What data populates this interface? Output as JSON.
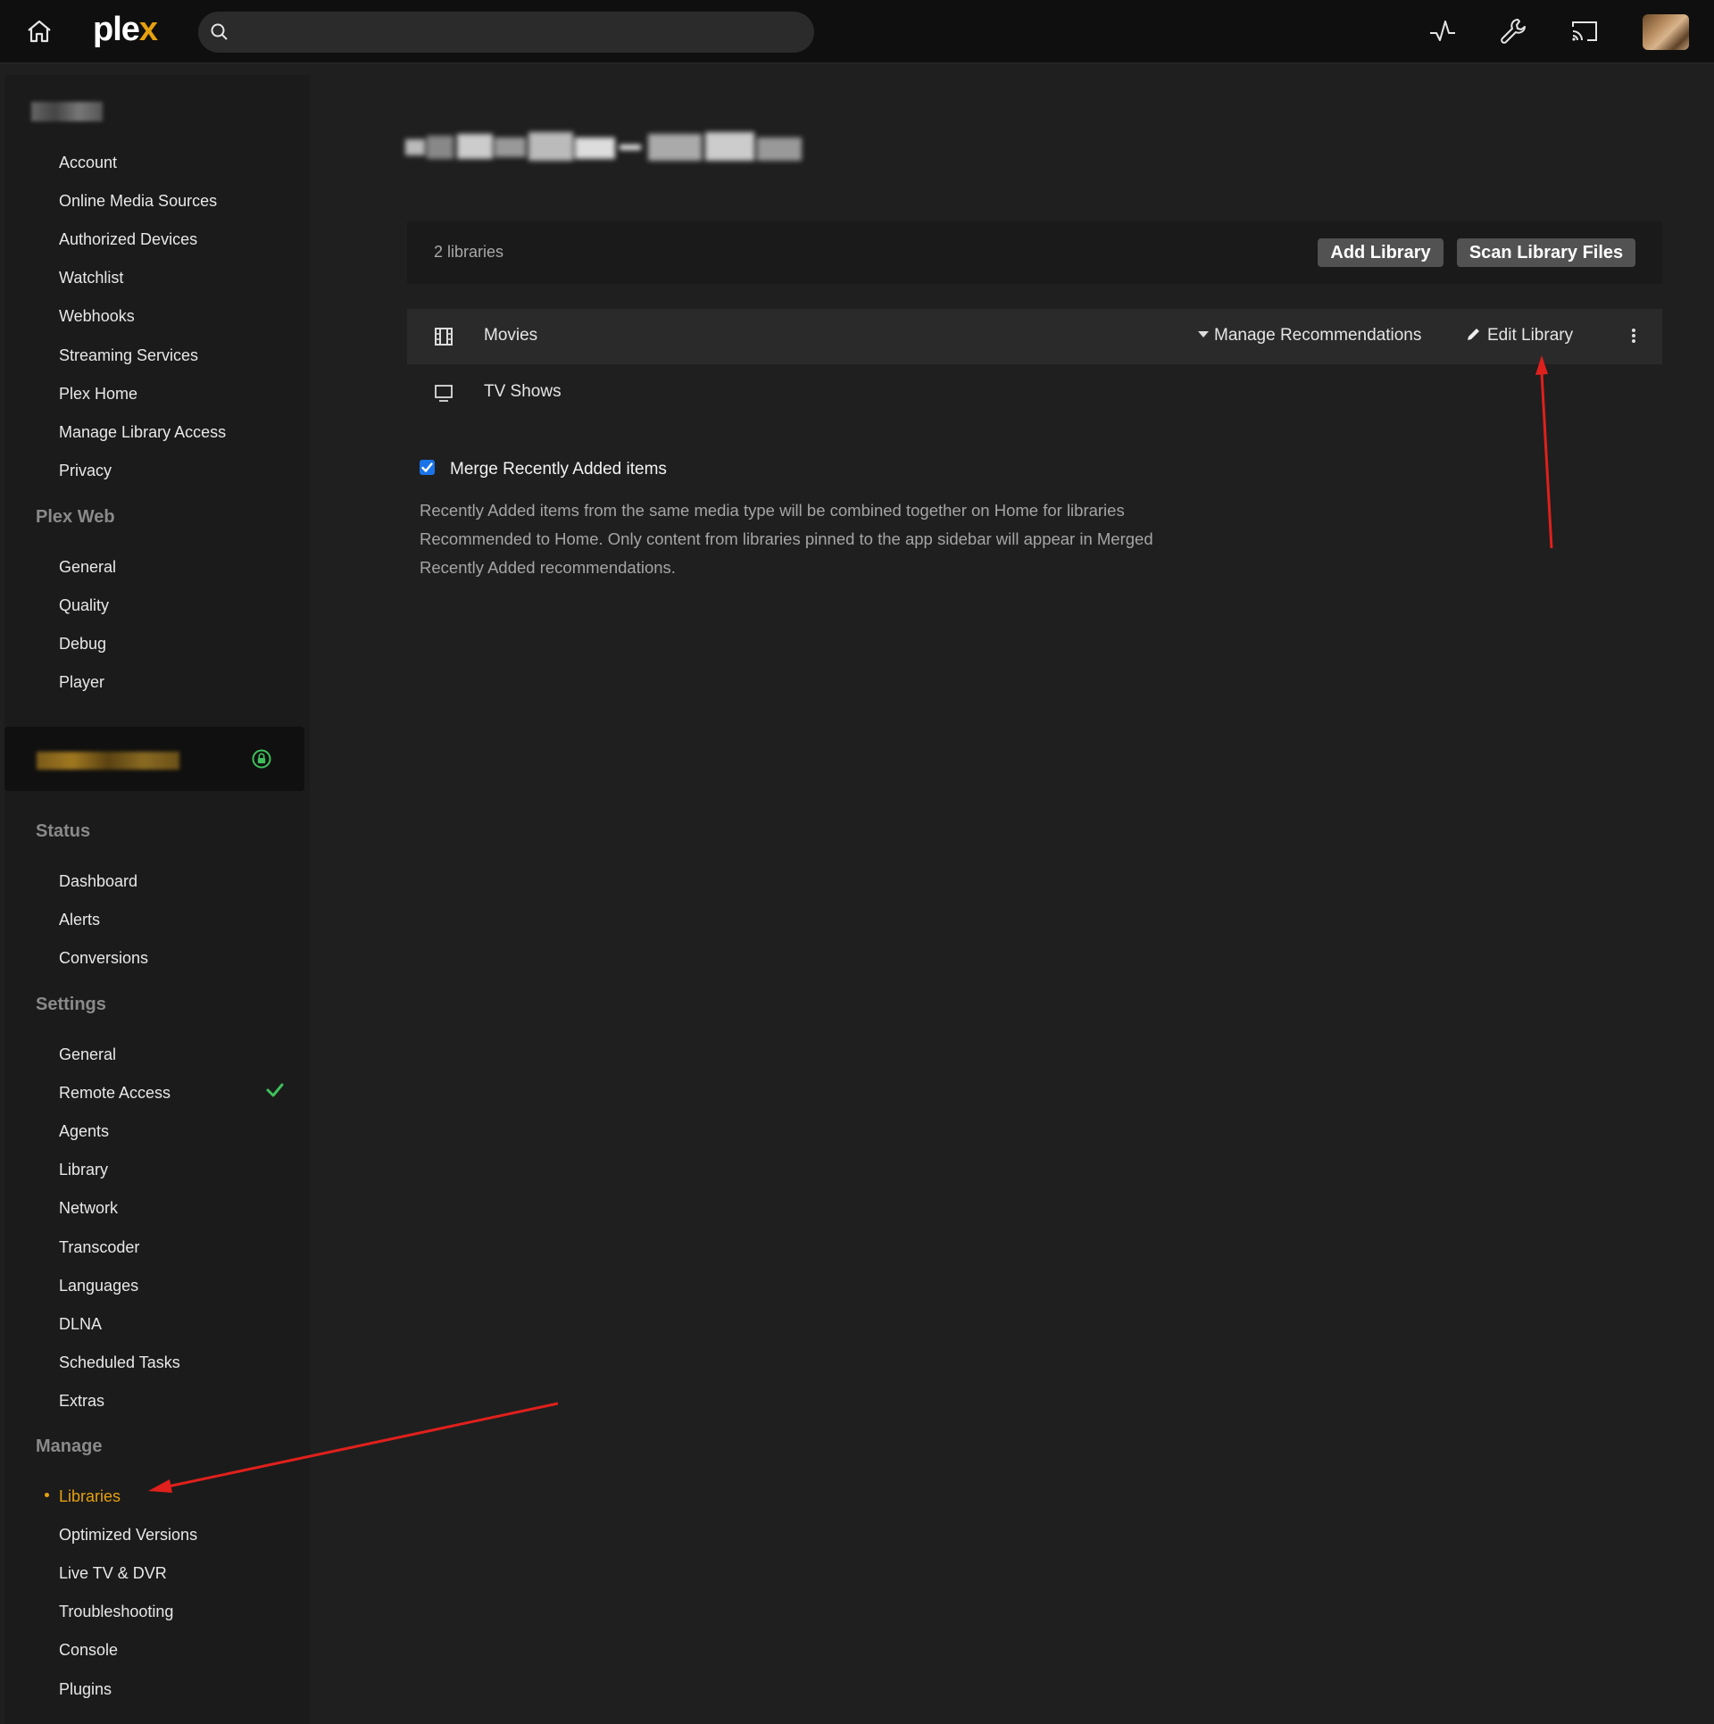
{
  "topbar": {
    "logo_main": "ple",
    "logo_accent": "x",
    "search_placeholder": ""
  },
  "sidebar": {
    "account_items": [
      "Account",
      "Online Media Sources",
      "Authorized Devices",
      "Watchlist",
      "Webhooks",
      "Streaming Services",
      "Plex Home",
      "Manage Library Access",
      "Privacy"
    ],
    "plex_web_heading": "Plex Web",
    "plex_web_items": [
      "General",
      "Quality",
      "Debug",
      "Player"
    ],
    "status_heading": "Status",
    "status_items": [
      "Dashboard",
      "Alerts",
      "Conversions"
    ],
    "settings_heading": "Settings",
    "settings_items": [
      "General",
      "Remote Access",
      "Agents",
      "Library",
      "Network",
      "Transcoder",
      "Languages",
      "DLNA",
      "Scheduled Tasks",
      "Extras"
    ],
    "manage_heading": "Manage",
    "manage_items": [
      "Libraries",
      "Optimized Versions",
      "Live TV & DVR",
      "Troubleshooting",
      "Console",
      "Plugins"
    ],
    "active_item": "Libraries"
  },
  "main": {
    "library_count": "2 libraries",
    "add_library_label": "Add Library",
    "scan_library_label": "Scan Library Files",
    "libraries": [
      {
        "name": "Movies",
        "icon": "film-icon"
      },
      {
        "name": "TV Shows",
        "icon": "tv-icon"
      }
    ],
    "manage_recommendations_label": "Manage Recommendations",
    "edit_library_label": "Edit Library",
    "merge_label": "Merge Recently Added items",
    "merge_checked": true,
    "merge_description": "Recently Added items from the same media type will be combined together on Home for libraries Recommended to Home. Only content from libraries pinned to the app sidebar will appear in Merged Recently Added recommendations."
  },
  "colors": {
    "accent": "#e5a00d",
    "annotation_arrow": "#e0201c",
    "checkbox": "#1a73e8",
    "success": "#3fbf5b"
  }
}
